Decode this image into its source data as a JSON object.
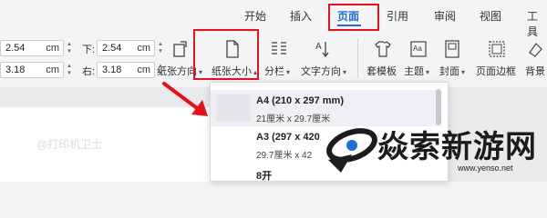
{
  "ribbon_tabs": [
    {
      "label": "开始"
    },
    {
      "label": "插入"
    },
    {
      "label": "页面"
    },
    {
      "label": "引用"
    },
    {
      "label": "审阅"
    },
    {
      "label": "视图"
    },
    {
      "label": "工具"
    }
  ],
  "margins": {
    "top_value": "2.54",
    "left_value": "3.18",
    "bottom_label": "下:",
    "bottom_value": "2.54",
    "right_label": "右:",
    "right_value": "3.18",
    "unit": "cm"
  },
  "toolbar": {
    "orientation_label": "纸张方向",
    "size_label": "纸张大小",
    "columns_label": "分栏",
    "text_direction_label": "文字方向",
    "template_label": "套模板",
    "theme_label": "主题",
    "cover_label": "封面",
    "border_label": "页面边框",
    "background_label": "背景"
  },
  "paper_sizes": [
    {
      "title": "A4 (210 x 297 mm)",
      "dims": "21厘米 x 29.7厘米"
    },
    {
      "title": "A3 (297 x 420",
      "dims": "29.7厘米 x 42"
    },
    {
      "title": "8开",
      "dims": ""
    }
  ],
  "watermark": "@打印机卫士",
  "logo": {
    "text": "焱索新游网",
    "url": "www.yenso.net"
  },
  "colors": {
    "accent": "#1e6fd9",
    "highlight_box": "#e8101a",
    "arrow": "#e8101a"
  }
}
